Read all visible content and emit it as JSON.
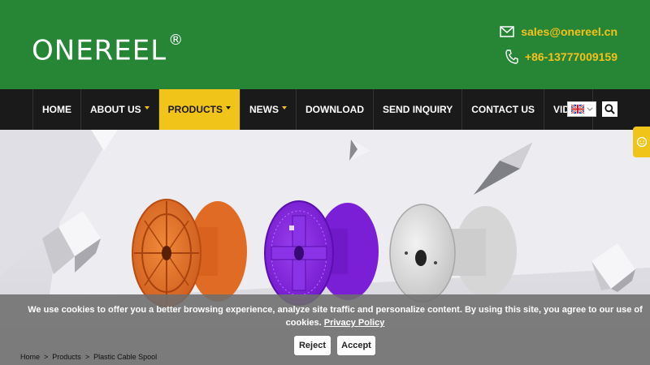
{
  "header": {
    "logo_text": "ONEREEL",
    "logo_mark": "®",
    "email": "sales@onereel.cn",
    "phone": "+86-13777009159"
  },
  "nav": {
    "items": [
      {
        "label": "HOME",
        "dropdown": false,
        "active": false
      },
      {
        "label": "ABOUT US",
        "dropdown": true,
        "active": false
      },
      {
        "label": "PRODUCTS",
        "dropdown": true,
        "active": true
      },
      {
        "label": "NEWS",
        "dropdown": true,
        "active": false
      },
      {
        "label": "DOWNLOAD",
        "dropdown": false,
        "active": false
      },
      {
        "label": "SEND INQUIRY",
        "dropdown": false,
        "active": false
      },
      {
        "label": "CONTACT US",
        "dropdown": false,
        "active": false
      },
      {
        "label": "VIDEO",
        "dropdown": false,
        "active": false
      }
    ],
    "language_icon": "uk-flag-icon",
    "search_icon": "search-icon"
  },
  "cookie": {
    "text": "We use cookies to offer you a better browsing experience, analyze site traffic and personalize content. By using this site, you agree to our use of cookies.",
    "policy_link": "Privacy Policy",
    "reject_label": "Reject",
    "accept_label": "Accept"
  },
  "breadcrumb": [
    "Home",
    "Products",
    "Plastic Cable Spool"
  ],
  "colors": {
    "header_green": "#278536",
    "accent_yellow": "#f0c419",
    "nav_dark": "#1a1a1a"
  }
}
